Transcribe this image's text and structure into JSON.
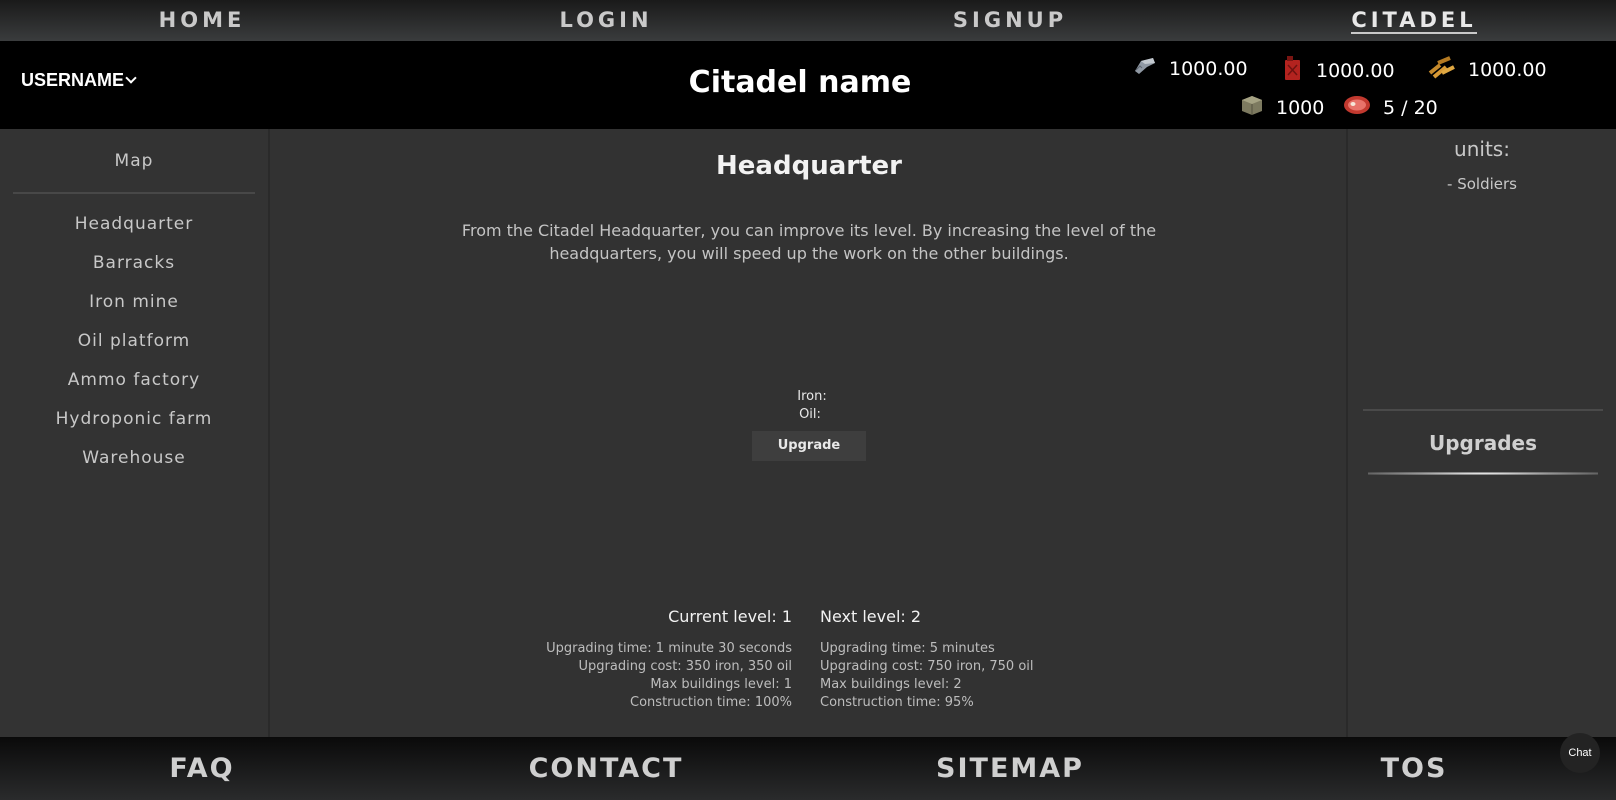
{
  "topnav": {
    "items": [
      "HOME",
      "LOGIN",
      "SIGNUP",
      "CITADEL"
    ],
    "active": "CITADEL"
  },
  "header": {
    "username": "USERNAME",
    "citadel_name": "Citadel name",
    "resources": {
      "iron": "1000.00",
      "oil": "1000.00",
      "ammo": "1000.00",
      "storage": "1000",
      "food": "5 / 20"
    }
  },
  "sidebar": {
    "map_label": "Map",
    "items": [
      "Headquarter",
      "Barracks",
      "Iron mine",
      "Oil platform",
      "Ammo factory",
      "Hydroponic farm",
      "Warehouse"
    ]
  },
  "main": {
    "title": "Headquarter",
    "description": "From the Citadel Headquarter, you can improve its level. By increasing the level of the headquarters, you will speed up the work on the other buildings.",
    "iron_label": "Iron:",
    "oil_label": "Oil:",
    "upgrade_button": "Upgrade",
    "current": {
      "title": "Current level: 1",
      "lines": [
        "Upgrading time: 1 minute 30 seconds",
        "Upgrading cost: 350 iron, 350 oil",
        "Max buildings level: 1",
        "Construction time: 100%"
      ]
    },
    "next": {
      "title": "Next level: 2",
      "lines": [
        "Upgrading time: 5 minutes",
        "Upgrading cost: 750 iron, 750 oil",
        "Max buildings level: 2",
        "Construction time: 95%"
      ]
    }
  },
  "right_panel": {
    "units_title": "units:",
    "units": [
      "- Soldiers"
    ],
    "upgrades_title": "Upgrades"
  },
  "footer": {
    "items": [
      "FAQ",
      "CONTACT",
      "SITEMAP",
      "TOS"
    ]
  },
  "chat_label": "Chat"
}
